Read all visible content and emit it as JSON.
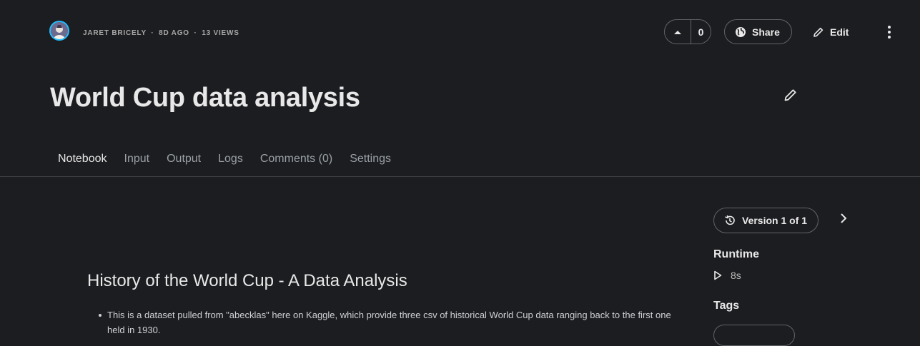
{
  "header": {
    "author": "JARET BRICELY",
    "age": "8D AGO",
    "views": "13 VIEWS",
    "separator": "·",
    "vote_count": "0",
    "share_label": "Share",
    "edit_label": "Edit"
  },
  "notebook": {
    "title": "World Cup data analysis"
  },
  "tabs": [
    {
      "label": "Notebook",
      "active": true
    },
    {
      "label": "Input"
    },
    {
      "label": "Output"
    },
    {
      "label": "Logs"
    },
    {
      "label": "Comments (0)"
    },
    {
      "label": "Settings"
    }
  ],
  "content": {
    "heading": "History of the World Cup - A Data Analysis",
    "bullets": [
      "This is a dataset pulled from \"abecklas\" here on Kaggle, which provide three csv of historical World Cup data ranging back to the first one held in 1930."
    ]
  },
  "sidebar": {
    "version_label": "Version 1 of 1",
    "runtime_heading": "Runtime",
    "runtime_value": "8s",
    "tags_heading": "Tags"
  },
  "colors": {
    "background": "#1c1d20",
    "avatar_ring": "#20beff"
  }
}
